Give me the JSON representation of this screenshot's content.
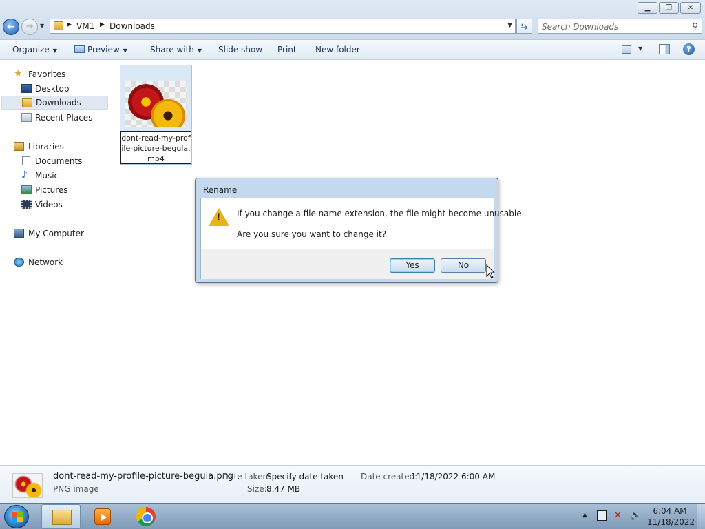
{
  "window": {
    "minimize_icon": "minimize-icon",
    "maximize_icon": "restore-icon",
    "close_icon": "close-icon"
  },
  "address_bar": {
    "breadcrumbs": [
      "VM1",
      "Downloads"
    ]
  },
  "search": {
    "placeholder": "Search Downloads"
  },
  "toolbar": {
    "organize": "Organize",
    "preview": "Preview",
    "share_with": "Share with",
    "slide_show": "Slide show",
    "print": "Print",
    "new_folder": "New folder"
  },
  "sidebar": {
    "favorites": {
      "label": "Favorites",
      "items": [
        "Desktop",
        "Downloads",
        "Recent Places"
      ],
      "selected": "Downloads"
    },
    "libraries": {
      "label": "Libraries",
      "items": [
        "Documents",
        "Music",
        "Pictures",
        "Videos"
      ]
    },
    "my_computer": "My Computer",
    "network": "Network"
  },
  "files": [
    {
      "name": "dont-read-my-profile-picture-begula.mp4",
      "editing": true
    }
  ],
  "dialog": {
    "title": "Rename",
    "message": "If you change a file name extension, the file might become unusable.",
    "question": "Are you sure you want to change it?",
    "yes": "Yes",
    "no": "No"
  },
  "details": {
    "file_name": "dont-read-my-profile-picture-begula.png",
    "file_type": "PNG image",
    "date_taken_label": "Date taken:",
    "date_taken_value": "Specify date taken",
    "size_label": "Size:",
    "size_value": "8.47 MB",
    "date_created_label": "Date created:",
    "date_created_value": "11/18/2022 6:00 AM"
  },
  "taskbar": {
    "time": "6:04 AM",
    "date": "11/18/2022"
  },
  "colors": {
    "accent": "#1e5fb3",
    "selection": "#dfe8f3",
    "dialog_frame": "#c4d9ef",
    "warning": "#e8b417"
  }
}
